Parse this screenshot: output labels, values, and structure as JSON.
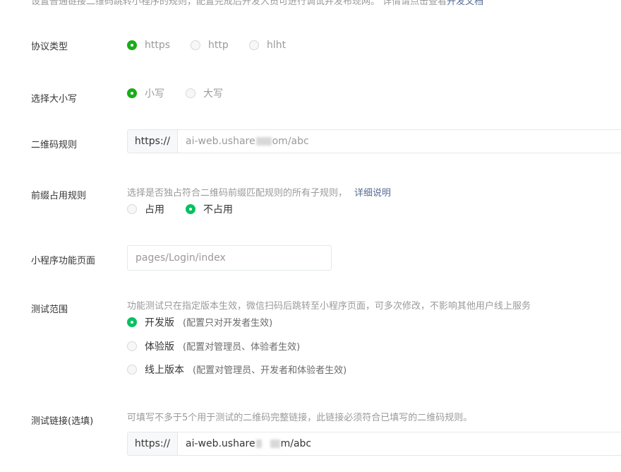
{
  "intro": {
    "text": "设置普通链接二维码跳转小程序的规则，配置完成后开发人员可进行调试并发布现网。 详情请点击查看",
    "link": "开发文档"
  },
  "protocol": {
    "label": "协议类型",
    "options": [
      {
        "text": "https",
        "selected": true
      },
      {
        "text": "http",
        "selected": false
      },
      {
        "text": "hlht",
        "selected": false
      }
    ]
  },
  "case": {
    "label": "选择大小写",
    "options": [
      {
        "text": "小写",
        "selected": true
      },
      {
        "text": "大写",
        "selected": false
      }
    ]
  },
  "qr_rule": {
    "label": "二维码规则",
    "prefix": "https://",
    "value_start": "ai-web.ushare",
    "value_end": "om/abc"
  },
  "prefix_rule": {
    "label": "前缀占用规则",
    "hint": "选择是否独占符合二维码前缀匹配规则的所有子规则，",
    "hint_link": "详细说明",
    "options": [
      {
        "text": "占用",
        "selected": false
      },
      {
        "text": "不占用",
        "selected": true
      }
    ]
  },
  "page": {
    "label": "小程序功能页面",
    "placeholder": "pages/Login/index"
  },
  "scope": {
    "label": "测试范围",
    "hint": "功能测试只在指定版本生效，微信扫码后跳转至小程序页面，可多次修改，不影响其他用户线上服务",
    "options": [
      {
        "text": "开发版",
        "note": "(配置只对开发者生效)",
        "selected": true
      },
      {
        "text": "体验版",
        "note": "(配置对管理员、体验者生效)",
        "selected": false
      },
      {
        "text": "线上版本",
        "note": "(配置对管理员、开发者和体验者生效)",
        "selected": false
      }
    ]
  },
  "test_link": {
    "label": "测试链接(选填)",
    "hint": "可填写不多于5个用于测试的二维码完整链接，此链接必须符合已填写的二维码规则。",
    "prefix": "https://",
    "value_start": "ai-web.ushare",
    "value_end": "m/abc"
  },
  "colors": {
    "accent": "#07c160",
    "link": "#576b95"
  }
}
